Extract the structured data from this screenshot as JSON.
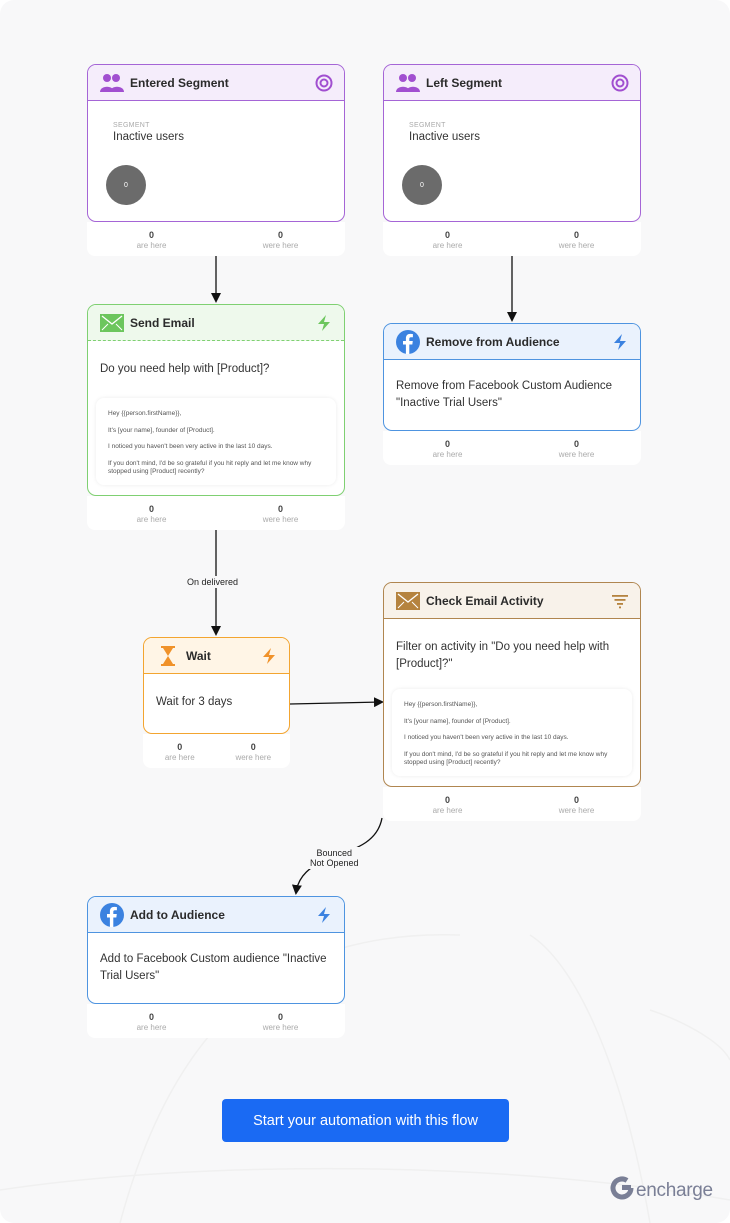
{
  "colors": {
    "purple": "#a565d6",
    "green": "#7fd072",
    "blue": "#4e94e0",
    "orange": "#f3a530",
    "brown": "#b08650",
    "cta": "#1a6af3",
    "brand": "#7a7f96"
  },
  "nodes": {
    "entered_segment": {
      "title": "Entered Segment",
      "icon": "users-icon",
      "action_icon": "target-icon",
      "segment_label": "SEGMENT",
      "segment_name": "Inactive users",
      "segment_count": "0",
      "are_here": "0",
      "are_here_label": "are here",
      "were_here": "0",
      "were_here_label": "were here"
    },
    "left_segment": {
      "title": "Left Segment",
      "icon": "users-icon",
      "action_icon": "target-icon",
      "segment_label": "SEGMENT",
      "segment_name": "Inactive users",
      "segment_count": "0",
      "are_here": "0",
      "are_here_label": "are here",
      "were_here": "0",
      "were_here_label": "were here"
    },
    "send_email": {
      "title": "Send Email",
      "icon": "envelope-icon",
      "action_icon": "lightning-icon",
      "subject": "Do you need help with [Product]?",
      "preview": [
        "Hey {{person.firstName}},",
        "It's [your name], founder of [Product].",
        "I noticed you haven't been very active in the last 10 days.",
        "If you don't mind, I'd be so grateful if you hit reply and let me know why stopped using [Product] recently?"
      ],
      "are_here": "0",
      "are_here_label": "are here",
      "were_here": "0",
      "were_here_label": "were here"
    },
    "remove_audience": {
      "title": "Remove from Audience",
      "icon": "facebook-icon",
      "action_icon": "lightning-icon",
      "body": "Remove from Facebook Custom Audience \"Inactive Trial Users\"",
      "are_here": "0",
      "are_here_label": "are here",
      "were_here": "0",
      "were_here_label": "were here"
    },
    "wait": {
      "title": "Wait",
      "icon": "hourglass-icon",
      "action_icon": "lightning-icon",
      "body": "Wait for 3 days",
      "are_here": "0",
      "are_here_label": "are here",
      "were_here": "0",
      "were_here_label": "were here"
    },
    "check_email": {
      "title": "Check Email Activity",
      "icon": "envelope-icon",
      "action_icon": "filter-icon",
      "body": "Filter on activity in \"Do you need help with [Product]?\"",
      "preview": [
        "Hey {{person.firstName}},",
        "It's [your name], founder of [Product].",
        "I noticed you haven't been very active in the last 10 days.",
        "If you don't mind, I'd be so grateful if you hit reply and let me know why stopped using [Product] recently?"
      ],
      "are_here": "0",
      "are_here_label": "are here",
      "were_here": "0",
      "were_here_label": "were here"
    },
    "add_audience": {
      "title": "Add to Audience",
      "icon": "facebook-icon",
      "action_icon": "lightning-icon",
      "body": "Add to Facebook Custom audience \"Inactive Trial Users\"",
      "are_here": "0",
      "are_here_label": "are here",
      "were_here": "0",
      "were_here_label": "were here"
    }
  },
  "edges": {
    "on_delivered": "On delivered",
    "bounced_line1": "Bounced",
    "bounced_line2": "Not Opened"
  },
  "cta": {
    "label": "Start your automation with this flow"
  },
  "brand": {
    "name": "encharge"
  }
}
